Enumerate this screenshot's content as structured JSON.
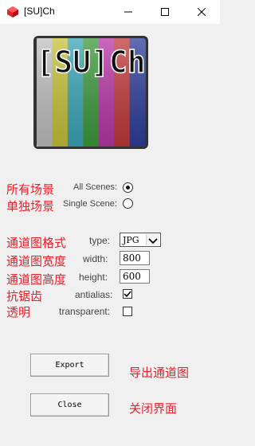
{
  "window": {
    "title": "[SU]Ch"
  },
  "logo": {
    "text": "[SU]Ch",
    "stripe_colors": [
      "#c0c0c0",
      "#c8c23a",
      "#3aa7b8",
      "#3f9a3e",
      "#b838a6",
      "#c23a3a",
      "#2f3f9a"
    ]
  },
  "annotations": {
    "all_scenes": "所有场景",
    "single_scene": "单独场景",
    "channel_format": "通道图格式",
    "channel_width": "通道图宽度",
    "channel_height": "通道图高度",
    "antialias": "抗锯齿",
    "transparent": "透明",
    "export": "导出通道图",
    "close": "关闭界面"
  },
  "scenes": {
    "all_label": "All Scenes:",
    "single_label": "Single Scene:",
    "selected": "all"
  },
  "settings": {
    "type_label": "type:",
    "type_value": "JPG",
    "width_label": "width:",
    "width_value": "800",
    "height_label": "height:",
    "height_value": "600",
    "antialias_label": "antialias:",
    "antialias_checked": true,
    "transparent_label": "transparent:",
    "transparent_checked": false
  },
  "buttons": {
    "export": "Export",
    "close": "Close"
  }
}
